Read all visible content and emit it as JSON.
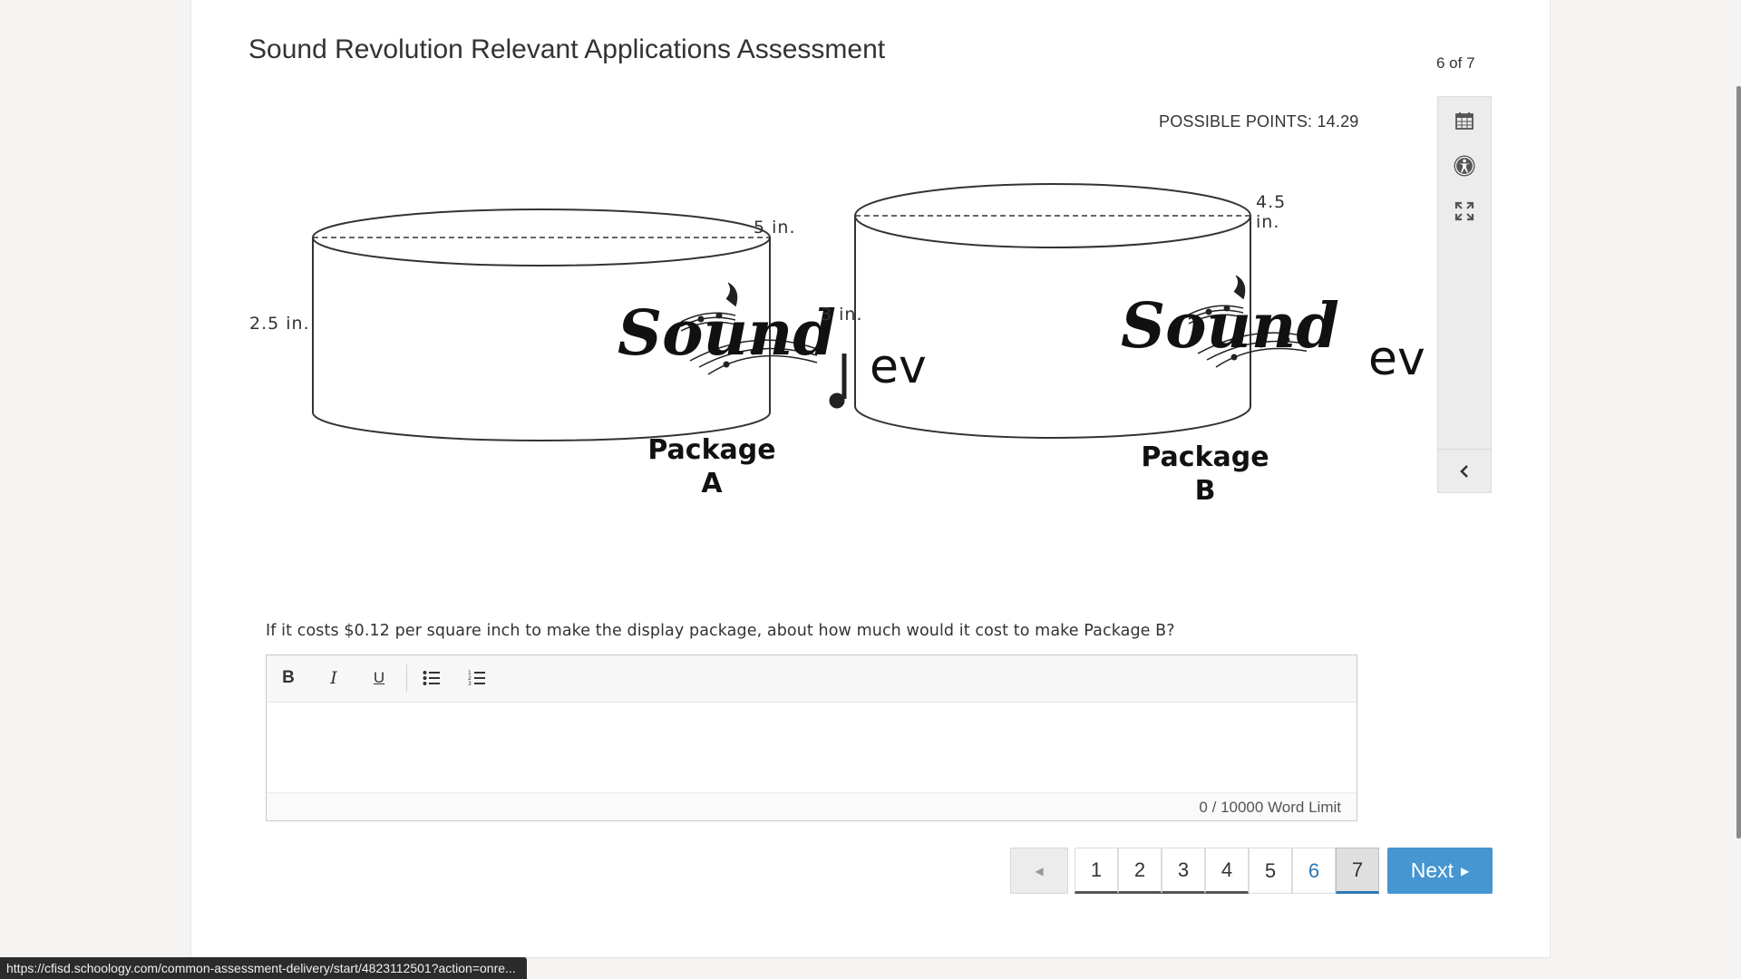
{
  "header": {
    "title": "Sound Revolution Relevant Applications Assessment",
    "counter": "6 of 7",
    "points": "POSSIBLE POINTS: 14.29"
  },
  "tools": {
    "icons": [
      "calendar-icon",
      "accessibility-icon",
      "fullscreen-icon",
      "chevron-left-icon"
    ]
  },
  "figure": {
    "package_a": {
      "diameter": "5 in.",
      "height": "2.5 in.",
      "label_line1": "Package",
      "label_line2": "A"
    },
    "package_b": {
      "diameter": "4.5 in.",
      "height": "3 in.",
      "label_line1": "Package",
      "label_line2": "B"
    },
    "logo_word": "Sound",
    "logo_suffix": "ev"
  },
  "question": {
    "text": "If it costs $0.12 per square inch to make the display package, about how much would it cost to make Package B?"
  },
  "editor": {
    "bold": "B",
    "italic": "I",
    "underline": "U",
    "word_count": "0",
    "word_limit": "/ 10000 Word Limit"
  },
  "pager": {
    "pages": [
      "1",
      "2",
      "3",
      "4",
      "5",
      "6",
      "7"
    ],
    "current": "6",
    "selected": "7",
    "next_label": "Next"
  },
  "status_url": "https://cfisd.schoology.com/common-assessment-delivery/start/4823112501?action=onre..."
}
